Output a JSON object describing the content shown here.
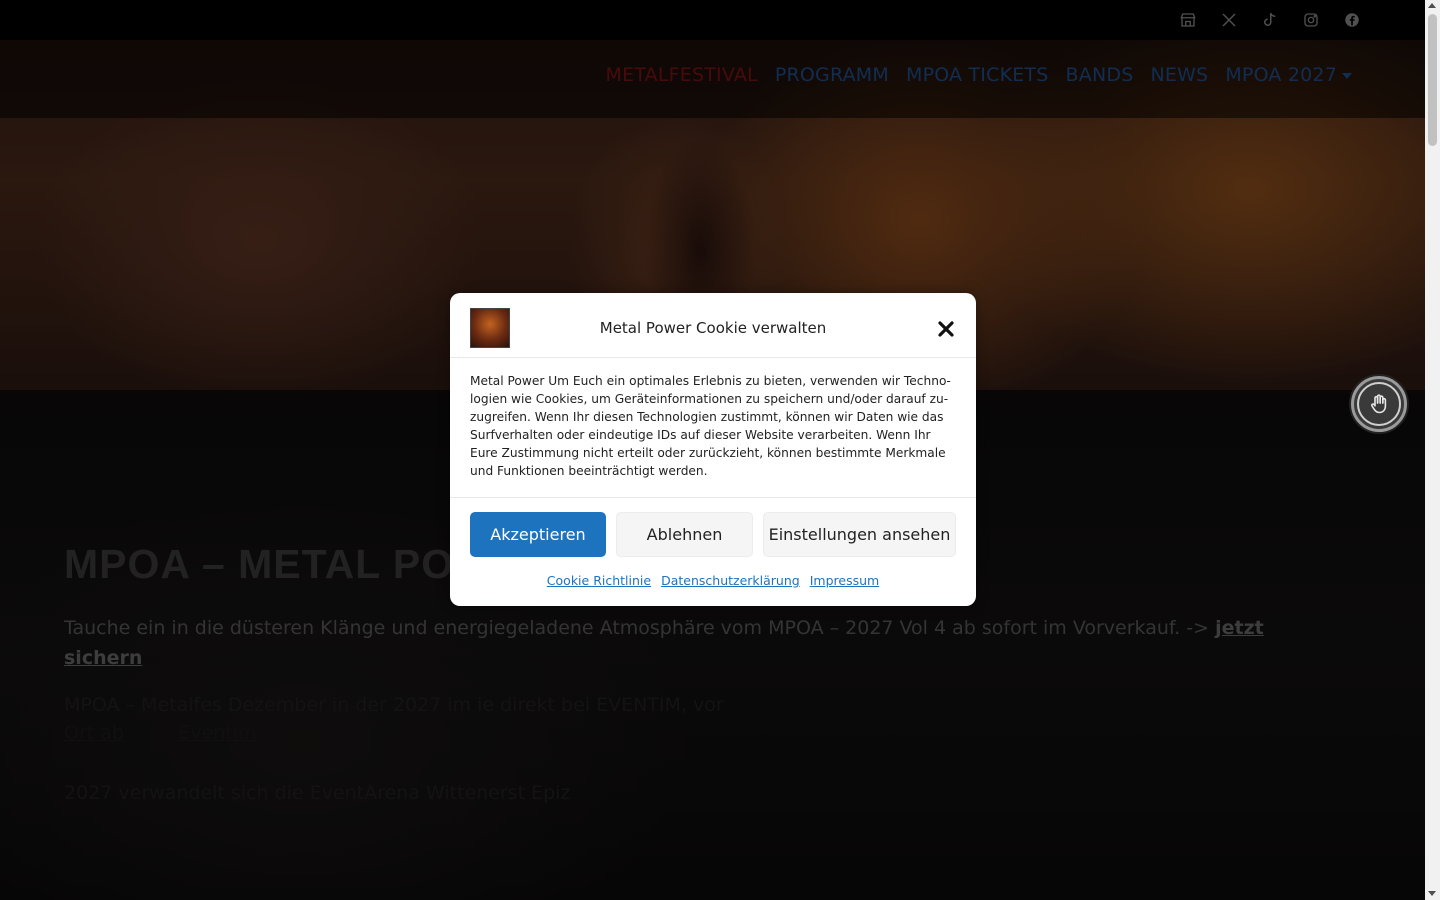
{
  "social": {
    "icons": [
      "store-icon",
      "x-icon",
      "tiktok-icon",
      "instagram-icon",
      "facebook-icon"
    ]
  },
  "nav": {
    "items": [
      {
        "label": "METALFESTIVAL",
        "active": true
      },
      {
        "label": "PROGRAMM"
      },
      {
        "label": "MPOA TICKETS"
      },
      {
        "label": "BANDS"
      },
      {
        "label": "NEWS"
      },
      {
        "label": "MPOA 2027",
        "dropdown": true
      }
    ]
  },
  "content": {
    "headline": "MPOA – METAL PO",
    "lead_text": "Tauche ein in die düsteren Klänge und energiegeladene Atmosphäre vom MPOA – 2027 Vol 4 ab sofort im Vorverkauf. ->",
    "lead_link": "jetzt sichern",
    "para1_text": "MPOA – Metalfes                    Dezember in der         2027 im                        ie direkt bei EVENTIM, vor",
    "para1_link1": "Ort ab",
    "para1_link2": "Eventim",
    "para2_text": "2027 verwandelt sich die EventArena Wittenerst           Epiz"
  },
  "cookie": {
    "title": "Metal Power Cookie verwalten",
    "body": "Metal Power Um Euch ein optimales Erlebnis zu bieten, verwenden wir Techno­logien wie Cookies, um Geräteinformationen zu speichern und/oder darauf zu­zugreifen. Wenn Ihr diesen Technologien zustimmt, können wir Daten wie das Surfverhalten oder eindeutige IDs auf dieser Website verarbeiten. Wenn Ihr Eure Zustimmung nicht erteilt oder zurückzieht, können bestimmte Merkmale und Funktionen beeinträchtigt werden.",
    "accept": "Akzeptieren",
    "deny": "Ablehnen",
    "preferences": "Einstellungen ansehen",
    "links": [
      "Cookie Richtlinie",
      "Datenschutzerklärung",
      "Impressum"
    ]
  },
  "colors": {
    "accent": "#1e73be",
    "nav_link": "#1e4f8c",
    "nav_active": "#7d1414"
  }
}
